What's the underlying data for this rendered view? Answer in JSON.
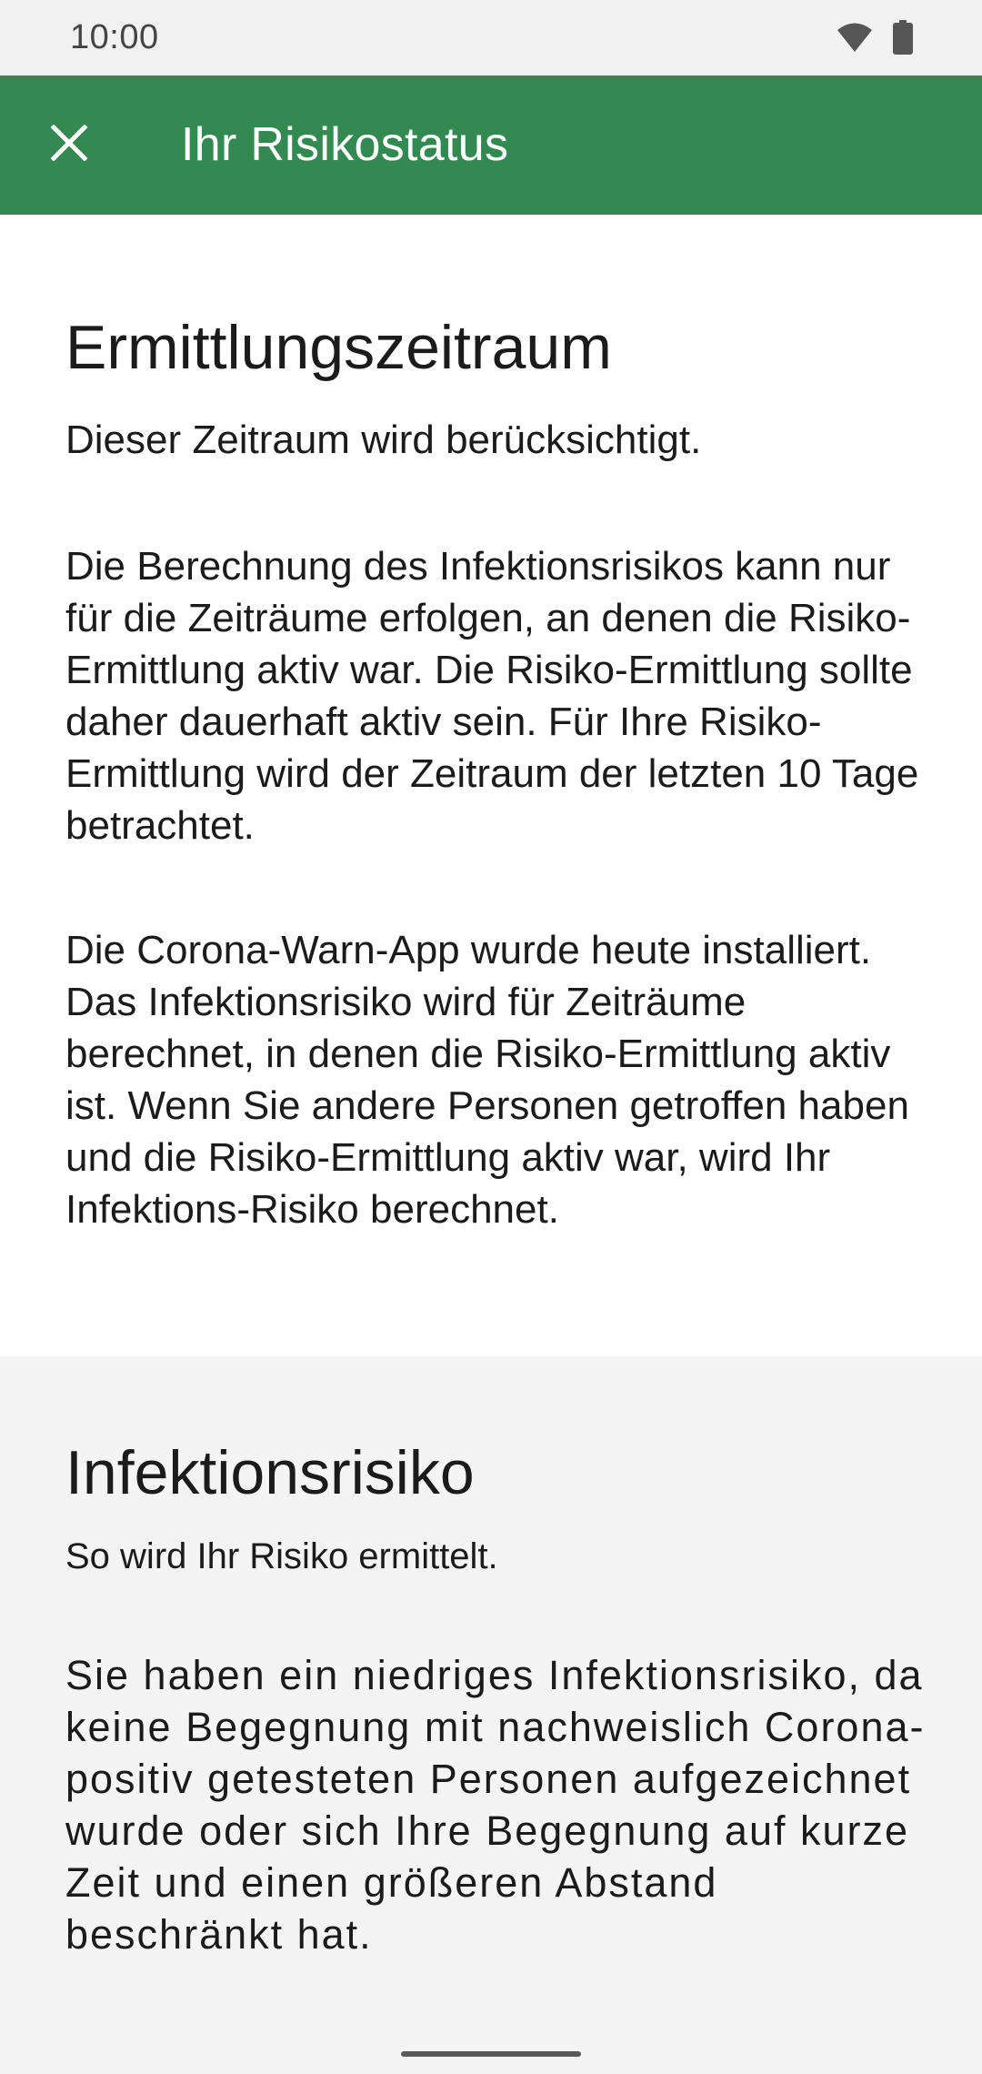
{
  "status_bar": {
    "time": "10:00",
    "icons": [
      "wifi-icon",
      "battery-icon"
    ]
  },
  "app_bar": {
    "title": "Ihr Risikostatus",
    "close_icon": "close-icon",
    "background_color": "#338a50"
  },
  "section_period": {
    "heading": "Ermittlungszeitraum",
    "subtitle": "Dieser Zeitraum wird berücksichtigt.",
    "paragraph_1": "Die Berechnung des Infektionsrisikos kann nur für die Zeiträume erfolgen, an denen die Risiko-Ermittlung aktiv war. Die Risiko-Ermittlung sollte daher dauerhaft aktiv sein. Für Ihre Risiko-Ermittlung wird der Zeitraum der letzten 10 Tage betrachtet.",
    "paragraph_2": "Die Corona-Warn-App wurde heute installiert. Das Infektionsrisiko wird für Zeiträume berechnet, in denen die Risiko-Ermittlung aktiv ist. Wenn Sie andere Personen getroffen haben und die Risiko-Ermittlung aktiv war, wird Ihr Infektions-Risiko berechnet."
  },
  "section_risk": {
    "heading": "Infektionsrisiko",
    "subtitle": "So wird Ihr Risiko ermittelt.",
    "paragraph": "Sie haben ein niedriges Infektionsrisiko, da keine Begegnung mit nachweislich Corona-positiv getesteten Personen aufgezeichnet wurde oder sich Ihre Begegnung auf kurze Zeit und einen größeren Abstand beschränkt hat."
  }
}
